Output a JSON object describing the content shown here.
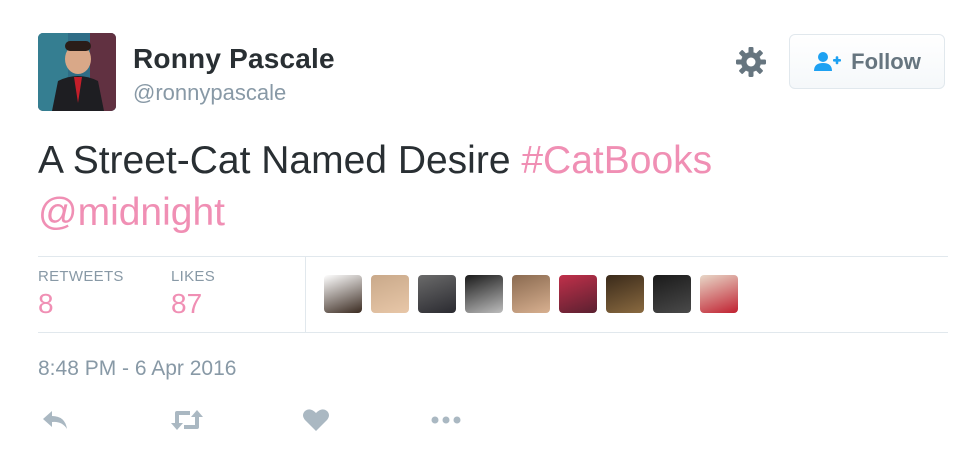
{
  "user": {
    "display_name": "Ronny Pascale",
    "handle": "@ronnypascale"
  },
  "actions": {
    "follow_label": "Follow"
  },
  "tweet": {
    "text": "A Street-Cat Named Desire ",
    "hashtag": "#CatBooks",
    "mention": "@midnight"
  },
  "stats": {
    "retweets_label": "RETWEETS",
    "retweets_count": "8",
    "likes_label": "LIKES",
    "likes_count": "87"
  },
  "likers": [
    {
      "name": "liker-avatar-1",
      "colors": [
        "#ffffff",
        "#3a2a20"
      ]
    },
    {
      "name": "liker-avatar-2",
      "colors": [
        "#c9a98a",
        "#e8c7a8"
      ]
    },
    {
      "name": "liker-avatar-3",
      "colors": [
        "#6a6a6a",
        "#2a2a30"
      ]
    },
    {
      "name": "liker-avatar-4",
      "colors": [
        "#1a1a1a",
        "#bdbdbd"
      ]
    },
    {
      "name": "liker-avatar-5",
      "colors": [
        "#8a6a50",
        "#d8b090"
      ]
    },
    {
      "name": "liker-avatar-6",
      "colors": [
        "#c0304a",
        "#5a2030"
      ]
    },
    {
      "name": "liker-avatar-7",
      "colors": [
        "#3a2a1a",
        "#8a6a40"
      ]
    },
    {
      "name": "liker-avatar-8",
      "colors": [
        "#1a1a1a",
        "#4a4a4a"
      ]
    },
    {
      "name": "liker-avatar-9",
      "colors": [
        "#e8d8c8",
        "#c02030"
      ]
    }
  ],
  "timestamp": "8:48 PM - 6 Apr 2016",
  "theme": {
    "link_color": "#f08fb4",
    "muted_color": "#8899a6",
    "icon_color": "#66757f",
    "action_icon_color": "#aab8c2"
  },
  "icons": {
    "settings": "gear-icon",
    "follow": "person-add-icon",
    "reply": "reply-icon",
    "retweet": "retweet-icon",
    "like": "heart-icon",
    "more": "more-dots-icon"
  }
}
